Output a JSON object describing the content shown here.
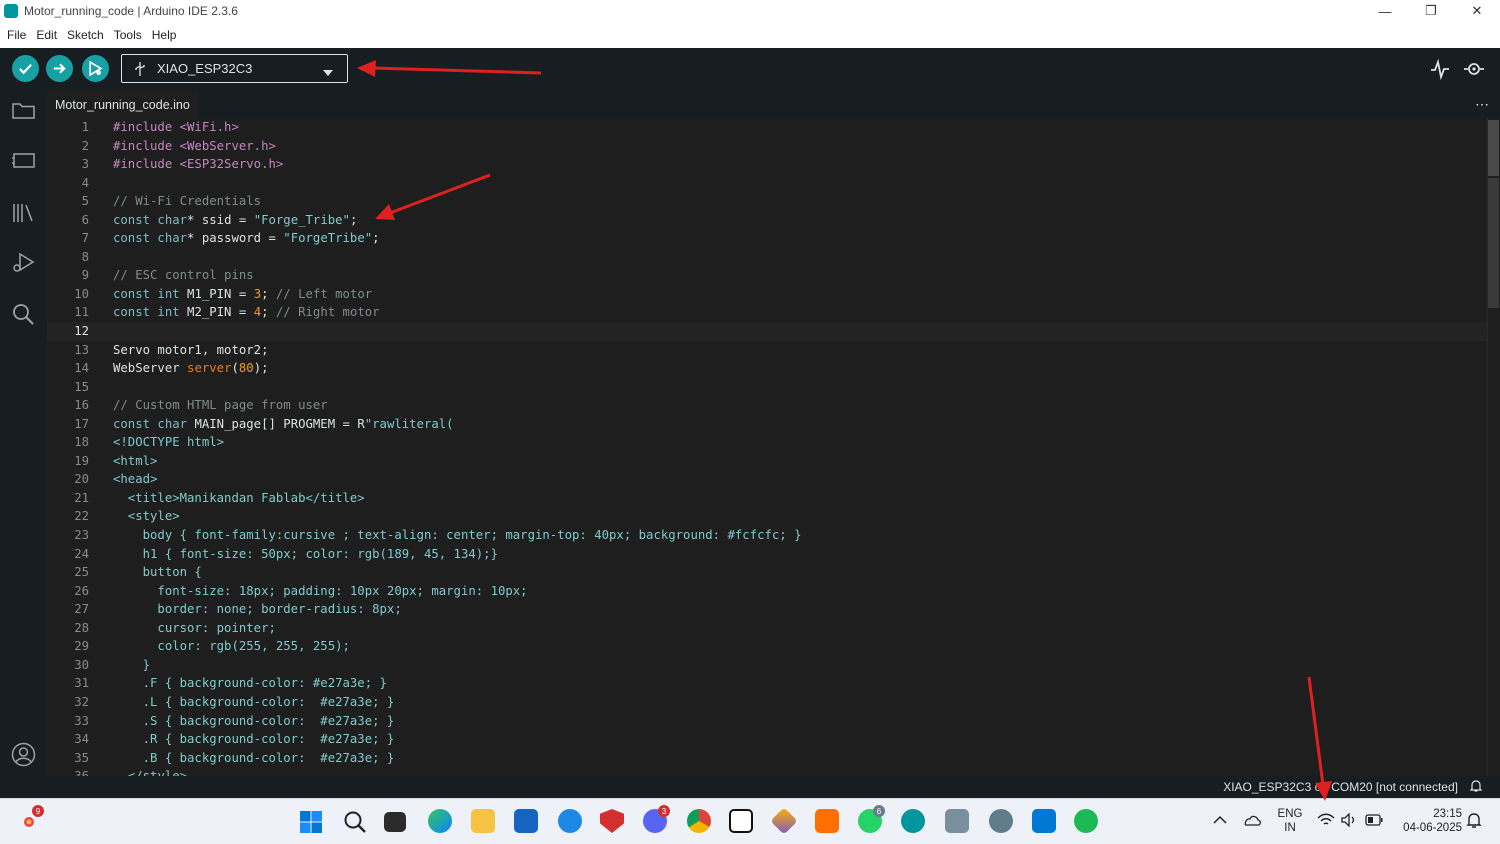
{
  "window": {
    "title": "Motor_running_code | Arduino IDE 2.3.6"
  },
  "menu": [
    "File",
    "Edit",
    "Sketch",
    "Tools",
    "Help"
  ],
  "toolbar": {
    "verify_icon": "check-icon",
    "upload_icon": "arrow-right-icon",
    "debug_icon": "debug-icon",
    "board": "XIAO_ESP32C3",
    "accent": "#17a1a5"
  },
  "tab": {
    "filename": "Motor_running_code.ino"
  },
  "editor": {
    "current_line": 12,
    "lines": [
      [
        {
          "t": "#include <WiFi.h>",
          "c": "pp"
        }
      ],
      [
        {
          "t": "#include <WebServer.h>",
          "c": "pp"
        }
      ],
      [
        {
          "t": "#include <ESP32Servo.h>",
          "c": "pp"
        }
      ],
      [],
      [
        {
          "t": "// Wi-Fi Credentials",
          "c": "cm"
        }
      ],
      [
        {
          "t": "const char",
          "c": "kw"
        },
        {
          "t": "* ssid = ",
          "c": "tx"
        },
        {
          "t": "\"Forge_Tribe\"",
          "c": "st"
        },
        {
          "t": ";",
          "c": "tx"
        }
      ],
      [
        {
          "t": "const char",
          "c": "kw"
        },
        {
          "t": "* password = ",
          "c": "tx"
        },
        {
          "t": "\"ForgeTribe\"",
          "c": "st"
        },
        {
          "t": ";",
          "c": "tx"
        }
      ],
      [],
      [
        {
          "t": "// ESC control pins",
          "c": "cm"
        }
      ],
      [
        {
          "t": "const int",
          "c": "kw"
        },
        {
          "t": " M1_PIN = ",
          "c": "tx"
        },
        {
          "t": "3",
          "c": "nm"
        },
        {
          "t": "; ",
          "c": "tx"
        },
        {
          "t": "// Left motor",
          "c": "cm"
        }
      ],
      [
        {
          "t": "const int",
          "c": "kw"
        },
        {
          "t": " M2_PIN = ",
          "c": "tx"
        },
        {
          "t": "4",
          "c": "nm"
        },
        {
          "t": "; ",
          "c": "tx"
        },
        {
          "t": "// Right motor",
          "c": "cm"
        }
      ],
      [],
      [
        {
          "t": "Servo motor1, motor2;",
          "c": "tx"
        }
      ],
      [
        {
          "t": "WebServer ",
          "c": "tx"
        },
        {
          "t": "server",
          "c": "fn"
        },
        {
          "t": "(",
          "c": "tx"
        },
        {
          "t": "80",
          "c": "nm"
        },
        {
          "t": ");",
          "c": "tx"
        }
      ],
      [],
      [
        {
          "t": "// Custom HTML page from user",
          "c": "cm"
        }
      ],
      [
        {
          "t": "const char",
          "c": "kw"
        },
        {
          "t": " MAIN_page[] PROGMEM = R",
          "c": "tx"
        },
        {
          "t": "\"rawliteral(",
          "c": "st"
        }
      ],
      [
        {
          "t": "<!DOCTYPE html>",
          "c": "st"
        }
      ],
      [
        {
          "t": "<html>",
          "c": "st"
        }
      ],
      [
        {
          "t": "<head>",
          "c": "st"
        }
      ],
      [
        {
          "t": "  <title>Manikandan Fablab</title>",
          "c": "st"
        }
      ],
      [
        {
          "t": "  <style>",
          "c": "st"
        }
      ],
      [
        {
          "t": "    body { font-family:cursive ; text-align: center; margin-top: 40px; background: #fcfcfc; }",
          "c": "st"
        }
      ],
      [
        {
          "t": "    h1 { font-size: 50px; color: rgb(189, 45, 134);}",
          "c": "st"
        }
      ],
      [
        {
          "t": "    button {",
          "c": "st"
        }
      ],
      [
        {
          "t": "      font-size: 18px; padding: 10px 20px; margin: 10px;",
          "c": "st"
        }
      ],
      [
        {
          "t": "      border: none; border-radius: 8px;",
          "c": "st"
        }
      ],
      [
        {
          "t": "      cursor: pointer;",
          "c": "st"
        }
      ],
      [
        {
          "t": "      color: rgb(255, 255, 255);",
          "c": "st"
        }
      ],
      [
        {
          "t": "    }",
          "c": "st"
        }
      ],
      [
        {
          "t": "    .F { background-color: #e27a3e; }",
          "c": "st"
        }
      ],
      [
        {
          "t": "    .L { background-color:  #e27a3e; }",
          "c": "st"
        }
      ],
      [
        {
          "t": "    .S { background-color:  #e27a3e; }",
          "c": "st"
        }
      ],
      [
        {
          "t": "    .R { background-color:  #e27a3e; }",
          "c": "st"
        }
      ],
      [
        {
          "t": "    .B { background-color:  #e27a3e; }",
          "c": "st"
        }
      ],
      [
        {
          "t": "  </style>",
          "c": "st"
        }
      ]
    ],
    "colors": {
      "pp": "#c586c0",
      "kw": "#7fbac6",
      "cm": "#7f8c8d",
      "st": "#7fcbcd",
      "nm": "#f39c12",
      "fn": "#e67e22",
      "tx": "#dae3e3"
    }
  },
  "status": {
    "text": "XIAO_ESP32C3 on COM20 [not connected]"
  },
  "taskbar": {
    "lang_line1": "ENG",
    "lang_line2": "IN",
    "time": "23:15",
    "date": "04-06-2025",
    "weather_badge": "9",
    "discord_badge": "3",
    "whatsapp_badge": "6"
  }
}
